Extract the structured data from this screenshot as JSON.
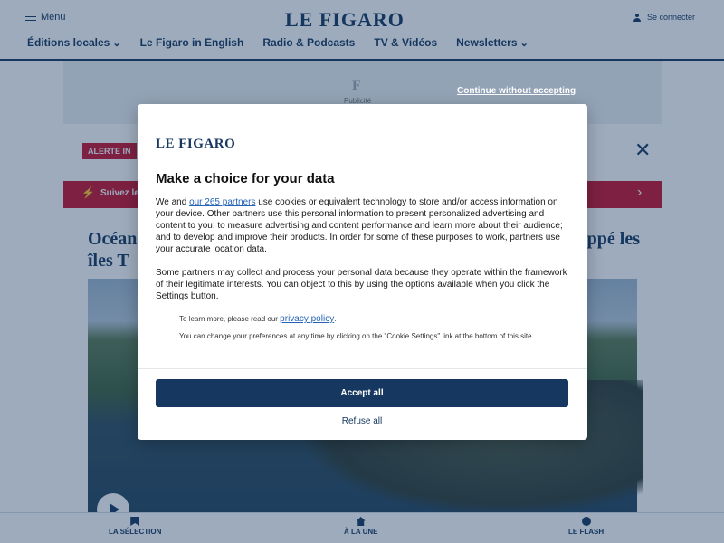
{
  "header": {
    "menu_label": "Menu",
    "logo_text": "LE FIGARO",
    "login_label": "Se connecter",
    "nav": [
      {
        "label": "Éditions locales",
        "has_dropdown": true
      },
      {
        "label": "Le Figaro in English",
        "has_dropdown": false
      },
      {
        "label": "Radio & Podcasts",
        "has_dropdown": false
      },
      {
        "label": "TV & Vidéos",
        "has_dropdown": false
      },
      {
        "label": "Newsletters",
        "has_dropdown": true
      }
    ]
  },
  "ad": {
    "label": "Publicité",
    "continue_link": "Continue without accepting"
  },
  "alert": {
    "badge": "ALERTE IN",
    "follow_text": "Suivez le"
  },
  "article": {
    "headline_line1": "Océan",
    "headline_line1_end": "ppé les",
    "headline_line2": "îles T"
  },
  "bottom_nav": [
    {
      "label": "LA SÉLECTION",
      "icon": "bookmark-icon"
    },
    {
      "label": "À LA UNE",
      "icon": "home-icon"
    },
    {
      "label": "LE FLASH",
      "icon": "flash-icon"
    }
  ],
  "consent": {
    "logo_text": "LE FIGARO",
    "title": "Make a choice for your data",
    "p1_before_link": "We and ",
    "p1_link": "our 265 partners",
    "p1_after_link": " use cookies or equivalent technology to store and/or access information on your device. Other partners use this personal information to present personalized advertising and content to you; to measure advertising and content performance and learn more about their audience; and to develop and improve their products. In order for some of these purposes to work, partners use your accurate location data.",
    "p2": "Some partners may collect and process your personal data because they operate within the framework of their legitimate interests. You can object to this by using the options available when you click the Settings button.",
    "small1_before_link": "To learn more, please read our ",
    "small1_link": "privacy policy",
    "small1_after_link": ".",
    "small2": "You can change your preferences at any time by clicking on the \"Cookie Settings\" link at the bottom of this site.",
    "accept_label": "Accept all",
    "refuse_label": "Refuse all"
  },
  "colors": {
    "brand_navy": "#163860",
    "alert_red": "#c8102e",
    "link_blue": "#2563b8"
  }
}
